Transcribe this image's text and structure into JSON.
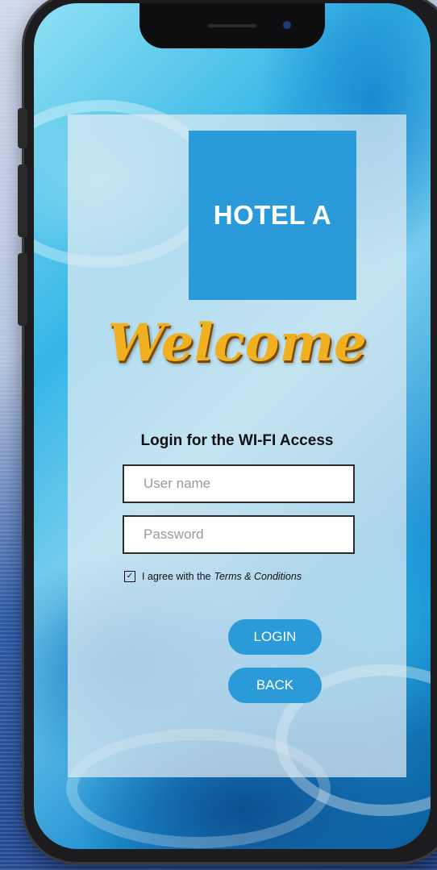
{
  "brand": {
    "logo_text": "HOTEL A",
    "accent_color": "#2b9ad8",
    "welcome_color": "#f0b020"
  },
  "welcome": {
    "text": "Welcome"
  },
  "login": {
    "subtitle": "Login for the WI-FI Access",
    "username_placeholder": "User name",
    "password_placeholder": "Password",
    "username_value": "",
    "password_value": "",
    "terms_prefix": "I agree with the",
    "terms_link": "Terms & Conditions",
    "terms_checked": true,
    "login_button": "LOGIN",
    "back_button": "BACK"
  },
  "icons": {
    "checkbox": "checkbox-checked-icon"
  }
}
